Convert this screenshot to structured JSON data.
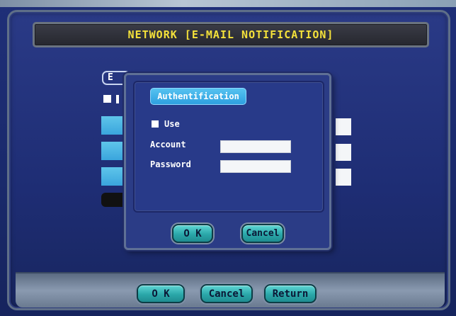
{
  "screen": {
    "title": "NETWORK [E-MAIL NOTIFICATION]"
  },
  "background_page": {
    "tab_label_partial": "E"
  },
  "dialog": {
    "section_tab": "Authentification",
    "use_label": "Use",
    "use_checked": false,
    "account_label": "Account",
    "account_value": "",
    "password_label": "Password",
    "password_value": "",
    "ok_label": "O K",
    "cancel_label": "Cancel"
  },
  "footer": {
    "ok_label": "O K",
    "cancel_label": "Cancel",
    "return_label": "Return"
  },
  "colors": {
    "title_text": "#f4e13a",
    "button_fill": "#2aa7a9",
    "tab_fill": "#3aa5dd",
    "screen_bg": "#1f2f78"
  }
}
